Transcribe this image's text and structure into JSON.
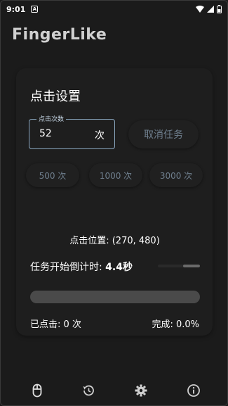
{
  "status_bar": {
    "time": "9:01",
    "notification_icon": "a-box-icon",
    "icons": [
      "wifi-icon",
      "signal-icon",
      "battery-icon"
    ]
  },
  "app": {
    "title": "FingerLike"
  },
  "settings": {
    "section_title": "点击设置",
    "count_field": {
      "label": "点击次数",
      "value": "52",
      "suffix": "次"
    },
    "cancel_label": "取消任务",
    "presets": [
      "500 次",
      "1000 次",
      "3000 次"
    ]
  },
  "status": {
    "click_position": "点击位置: (270, 480)",
    "countdown_label": "任务开始倒计时: ",
    "countdown_value": "4.4秒",
    "countdown_progress": 0.4,
    "task_progress": 0.0,
    "clicked": "已点击: 0 次",
    "completion": "完成: 0.0%"
  },
  "bottom_nav": {
    "items": [
      "mouse-icon",
      "history-icon",
      "gear-icon",
      "info-icon"
    ],
    "active": "mouse-icon"
  },
  "colors": {
    "background": "#1b1b1b",
    "card": "#1e1e1e",
    "accent": "#8aa7c0",
    "muted_text": "#6f7f8e"
  }
}
